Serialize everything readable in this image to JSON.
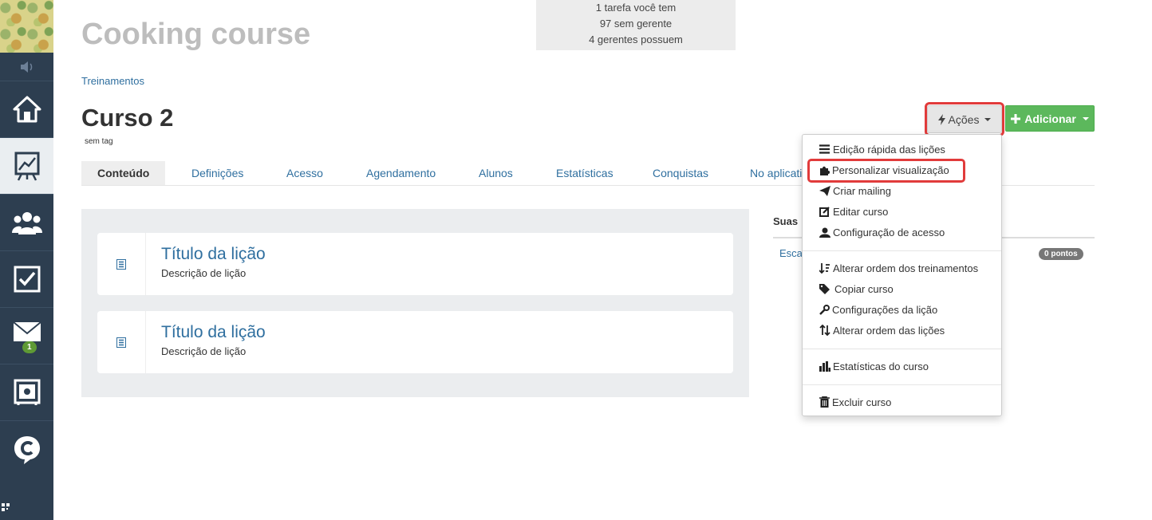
{
  "sidebar": {
    "notification_badge": "1",
    "qr_glyph": "█"
  },
  "infobox": {
    "line1": "1 tarefa você tem",
    "line2": "97 sem gerente",
    "line3": "4 gerentes possuem"
  },
  "app_title": "Cooking course",
  "breadcrumb": "Treinamentos",
  "page_title": "Curso 2",
  "tagline": "sem tag",
  "buttons": {
    "acoes": "Ações",
    "adicionar": "Adicionar"
  },
  "tabs": [
    "Conteúdo",
    "Definições",
    "Acesso",
    "Agendamento",
    "Alunos",
    "Estatísticas",
    "Conquistas",
    "No aplicativo"
  ],
  "lessons": [
    {
      "title": "Título da lição",
      "description": "Descrição de lição"
    },
    {
      "title": "Título da lição",
      "description": "Descrição de lição"
    }
  ],
  "side_panel": {
    "heading": "Suas",
    "link": "Esca",
    "points_badge": "0 pontos"
  },
  "dropdown": {
    "items": [
      "Edição rápida das lições",
      "Personalizar visualização",
      "Criar mailing",
      "Editar curso",
      "Configuração de acesso",
      "Alterar ordem dos treinamentos",
      "Copiar curso",
      "Configurações da lição",
      "Alterar ordem das lições",
      "Estatísticas do curso",
      "Excluir curso"
    ]
  },
  "colors": {
    "sidebar_bg": "#2d3e50",
    "link_blue": "#2f6f9f",
    "add_green": "#5cb85c",
    "highlight_red": "#e13b3b"
  }
}
